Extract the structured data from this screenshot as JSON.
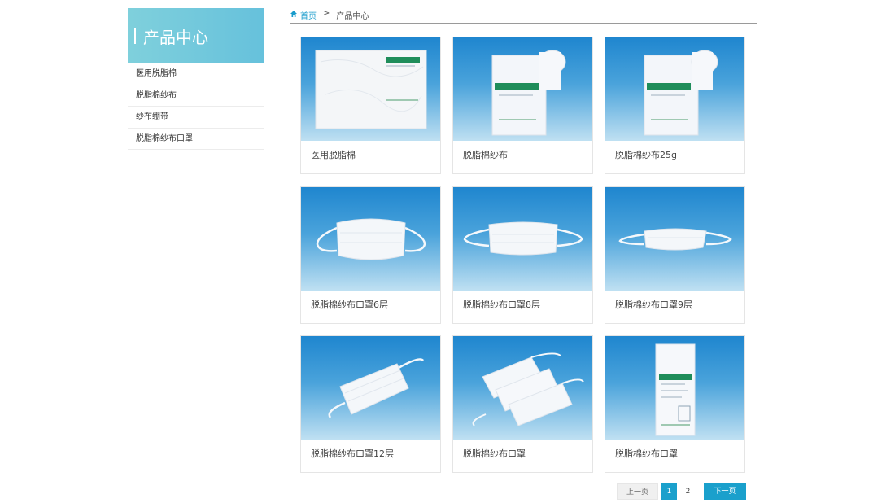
{
  "sidebar": {
    "title": "产品中心",
    "items": [
      {
        "label": "医用脱脂棉"
      },
      {
        "label": "脱脂棉纱布"
      },
      {
        "label": "纱布绷带"
      },
      {
        "label": "脱脂棉纱布口罩"
      }
    ]
  },
  "breadcrumb": {
    "home": "首页",
    "separator": ">",
    "current": "产品中心"
  },
  "products": [
    {
      "title": "医用脱脂棉",
      "image": "cotton-pack"
    },
    {
      "title": "脱脂棉纱布",
      "image": "gauze-roll"
    },
    {
      "title": "脱脂棉纱布25g",
      "image": "gauze-roll"
    },
    {
      "title": "脱脂棉纱布口罩6层",
      "image": "mask"
    },
    {
      "title": "脱脂棉纱布口罩8层",
      "image": "mask"
    },
    {
      "title": "脱脂棉纱布口罩9层",
      "image": "mask"
    },
    {
      "title": "脱脂棉纱布口罩12层",
      "image": "mask-angled"
    },
    {
      "title": "脱脂棉纱布口罩",
      "image": "mask-group"
    },
    {
      "title": "脱脂棉纱布口罩",
      "image": "mask-package"
    }
  ],
  "pagination": {
    "prev": "上一页",
    "pages": [
      "1",
      "2"
    ],
    "current": "1",
    "next": "下一页"
  },
  "colors": {
    "accent": "#1aa0cc",
    "sidebar_header": "#6cc6dc",
    "image_bg_top": "#1f86cf",
    "image_bg_bottom": "#bfe0f2"
  }
}
